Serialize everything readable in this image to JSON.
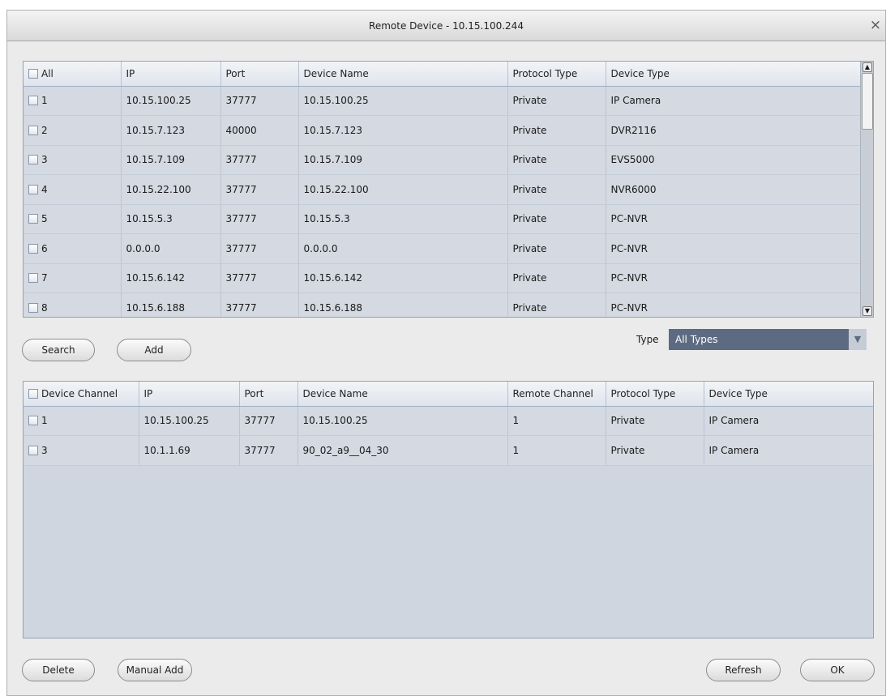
{
  "window": {
    "title": "Remote Device - 10.15.100.244",
    "close_glyph": "×"
  },
  "search_grid": {
    "headers": [
      "All",
      "IP",
      "Port",
      "Device Name",
      "Protocol Type",
      "Device Type"
    ],
    "rows": [
      [
        "1",
        "10.15.100.25",
        "37777",
        "10.15.100.25",
        "Private",
        "IP Camera"
      ],
      [
        "2",
        "10.15.7.123",
        "40000",
        "10.15.7.123",
        "Private",
        "DVR2116"
      ],
      [
        "3",
        "10.15.7.109",
        "37777",
        "10.15.7.109",
        "Private",
        "EVS5000"
      ],
      [
        "4",
        "10.15.22.100",
        "37777",
        "10.15.22.100",
        "Private",
        "NVR6000"
      ],
      [
        "5",
        "10.15.5.3",
        "37777",
        "10.15.5.3",
        "Private",
        "PC-NVR"
      ],
      [
        "6",
        "0.0.0.0",
        "37777",
        "0.0.0.0",
        "Private",
        "PC-NVR"
      ],
      [
        "7",
        "10.15.6.142",
        "37777",
        "10.15.6.142",
        "Private",
        "PC-NVR"
      ],
      [
        "8",
        "10.15.6.188",
        "37777",
        "10.15.6.188",
        "Private",
        "PC-NVR"
      ]
    ]
  },
  "buttons": {
    "search": "Search",
    "add": "Add",
    "delete": "Delete",
    "manual_add": "Manual Add",
    "refresh": "Refresh",
    "ok": "OK"
  },
  "type_filter": {
    "label": "Type",
    "value": "All Types"
  },
  "added_grid": {
    "headers": [
      "Device Channel",
      "IP",
      "Port",
      "Device Name",
      "Remote Channel",
      "Protocol Type",
      "Device Type"
    ],
    "rows": [
      [
        "1",
        "10.15.100.25",
        "37777",
        "10.15.100.25",
        "1",
        "Private",
        "IP Camera"
      ],
      [
        "3",
        "10.1.1.69",
        "37777",
        "90_02_a9__04_30",
        "1",
        "Private",
        "IP Camera"
      ]
    ]
  },
  "icons": {
    "close": "close-icon",
    "scroll_up": "scroll-up-icon",
    "scroll_down": "scroll-down-icon",
    "dropdown": "dropdown-arrow-icon"
  }
}
